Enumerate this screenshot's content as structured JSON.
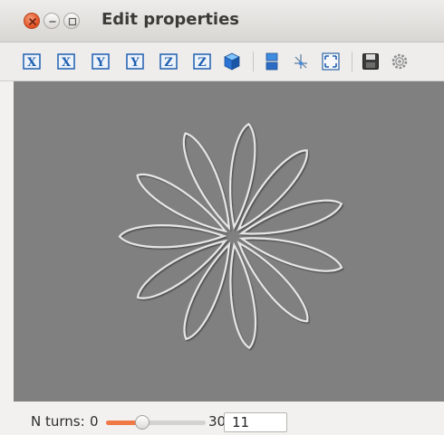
{
  "window": {
    "title": "Edit properties"
  },
  "toolbar": {
    "buttons": [
      {
        "icon": "view-x-icon",
        "glyph": "X"
      },
      {
        "icon": "view-x-reverse-icon",
        "glyph": "X"
      },
      {
        "icon": "view-y-icon",
        "glyph": "Y"
      },
      {
        "icon": "view-y-reverse-icon",
        "glyph": "Y"
      },
      {
        "icon": "view-z-icon",
        "glyph": "Z"
      },
      {
        "icon": "view-z-reverse-icon",
        "glyph": "Z"
      },
      {
        "icon": "isometric-view-icon"
      },
      {
        "icon": "parallel-projection-icon"
      },
      {
        "icon": "axes-icon"
      },
      {
        "icon": "fullscreen-icon"
      },
      {
        "icon": "save-icon"
      },
      {
        "icon": "settings-icon"
      }
    ]
  },
  "status": {
    "label": "N turns:",
    "min_label": "0",
    "max_label": "30",
    "slider_min": 0,
    "slider_max": 30,
    "value": "11"
  },
  "colors": {
    "plot_background": "#808080",
    "slider_accent": "#f07746",
    "view_button": "#1f5fb0"
  }
}
